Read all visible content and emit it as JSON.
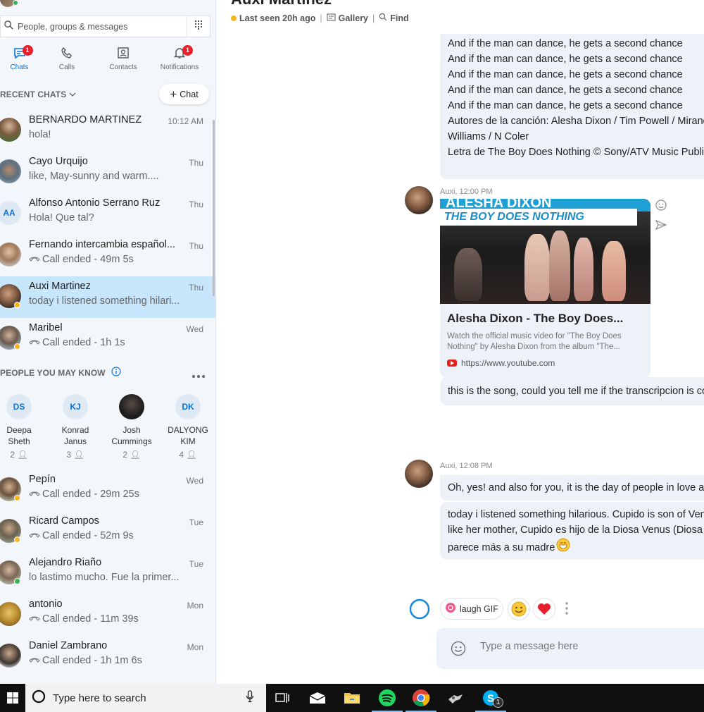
{
  "header": {
    "title": "Auxi Martinez",
    "status": "Last seen 20h ago",
    "gallery_label": "Gallery",
    "find_label": "Find"
  },
  "sidebar": {
    "search_placeholder": "People, groups & messages",
    "nav": [
      {
        "label": "Chats",
        "badge": "1"
      },
      {
        "label": "Calls",
        "badge": ""
      },
      {
        "label": "Contacts",
        "badge": ""
      },
      {
        "label": "Notifications",
        "badge": "1"
      }
    ],
    "recent_chats_label": "RECENT CHATS",
    "new_chat_label": "Chat",
    "chats": [
      {
        "name": "BERNARDO MARTINEZ",
        "preview": "hola!",
        "time": "10:12 AM",
        "call": false
      },
      {
        "name": "Cayo Urquijo",
        "preview": "like, May-sunny and warm....",
        "time": "Thu",
        "call": false
      },
      {
        "name": "Alfonso Antonio Serrano Ruz",
        "initials": "AA",
        "preview": "Hola! Que tal?",
        "time": "Thu",
        "call": false
      },
      {
        "name": "Fernando intercambia español...",
        "preview": "Call ended - 49m 5s",
        "time": "Thu",
        "call": true
      },
      {
        "name": "Auxi Martinez",
        "preview": "today i listened something hilari...",
        "time": "Thu",
        "call": false
      },
      {
        "name": "Maribel",
        "preview": "Call ended - 1h 1s",
        "time": "Wed",
        "call": true
      }
    ],
    "pymk_label": "PEOPLE YOU MAY KNOW",
    "pymk": [
      {
        "initials": "DS",
        "name_line1": "Deepa",
        "name_line2": "Sheth",
        "mutual": "2"
      },
      {
        "initials": "KJ",
        "name_line1": "Konrad",
        "name_line2": "Janus",
        "mutual": "3"
      },
      {
        "initials": "",
        "name_line1": "Josh",
        "name_line2": "Cummings",
        "mutual": "2"
      },
      {
        "initials": "DK",
        "name_line1": "DALYONG",
        "name_line2": "KIM",
        "mutual": "4"
      }
    ],
    "chats2": [
      {
        "name": "Pepín",
        "preview": "Call ended - 29m 25s",
        "time": "Wed",
        "call": true
      },
      {
        "name": "Ricard Campos",
        "preview": "Call ended - 52m 9s",
        "time": "Tue",
        "call": true
      },
      {
        "name": "Alejandro Riaño",
        "preview": "lo lastimo mucho. Fue la primer...",
        "time": "Tue",
        "call": false
      },
      {
        "name": "antonio",
        "preview": "Call ended - 11m 39s",
        "time": "Mon",
        "call": true
      },
      {
        "name": "Daniel Zambrano",
        "preview": "Call ended - 1h 1m 6s",
        "time": "Mon",
        "call": true
      }
    ]
  },
  "conversation": {
    "lyrics": [
      "And if the man can dance, he gets a second chance",
      "And if the man can dance, he gets a second chance",
      "And if the man can dance, he gets a second chance",
      "And if the man can dance, he gets a second chance",
      "And if the man can dance, he gets a second chance",
      "Autores de la canción: Alesha Dixon / Tim Powell / Miranda",
      "Williams / N Coler",
      "Letra de The Boy Does Nothing © Sony/ATV Music Publishi"
    ],
    "msg1_meta": "Auxi, 12:00 PM",
    "link": {
      "banner_top": "ALESHA DIXON",
      "banner_bottom": "THE BOY DOES NOTHING",
      "title": "Alesha Dixon - The Boy Does...",
      "description": "Watch the official music video for \"The Boy Does Nothing\" by Alesha Dixon from the album \"The...",
      "url": "https://www.youtube.com"
    },
    "msg1_text": "this is the song, could you tell me if the transcripcion is corr",
    "msg2_meta": "Auxi, 12:08 PM",
    "msg2_text": "Oh, yes! and also for you, it is the day of people in love and",
    "msg3_lines": [
      "today i listened something hilarious. Cupido is son of Venus",
      "like her mother, Cupido es hijo de la Diosa Venus  (Diosa de",
      "parece más a su madre"
    ],
    "suggest_chip": "laugh GIF",
    "composer_placeholder": "Type a message here"
  },
  "taskbar": {
    "search_placeholder": "Type here to search",
    "skype_badge": "1"
  },
  "colors": {
    "accent": "#0a73d9",
    "selected_row": "#c7e5fb",
    "badge": "#e6212b",
    "away": "#f6b31b",
    "online": "#37b24d"
  }
}
